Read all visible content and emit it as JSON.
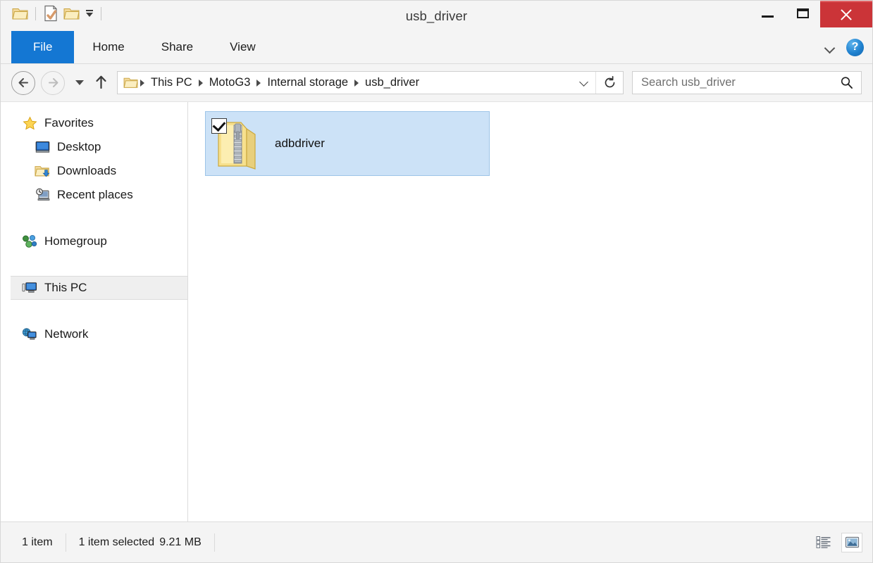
{
  "window": {
    "title": "usb_driver",
    "quick_access": {
      "app_icon": "folder-icon",
      "items": [
        {
          "name": "properties-icon",
          "label": "Properties"
        },
        {
          "name": "new-folder-icon",
          "label": "New folder"
        },
        {
          "name": "customize-caret-icon",
          "label": "Customize Quick Access Toolbar"
        }
      ]
    },
    "controls": {
      "minimize": "Minimize",
      "maximize": "Maximize",
      "close": "Close"
    },
    "accent_blue": "#1477d3",
    "close_red": "#cb3438",
    "selection_blue": "#cce2f7"
  },
  "ribbon": {
    "tabs": [
      {
        "label": "File",
        "active": true
      },
      {
        "label": "Home",
        "active": false
      },
      {
        "label": "Share",
        "active": false
      },
      {
        "label": "View",
        "active": false
      }
    ],
    "expand_label": "Expand the Ribbon",
    "help_label": "?"
  },
  "address": {
    "back_label": "Back",
    "forward_label": "Forward",
    "recent_label": "Recent locations",
    "up_label": "Up one level",
    "folder_icon": "folder-icon",
    "breadcrumbs": [
      "This PC",
      "MotoG3",
      "Internal storage",
      "usb_driver"
    ],
    "dropdown_label": "Previous locations",
    "refresh_label": "Refresh"
  },
  "search": {
    "placeholder": "Search usb_driver",
    "icon": "search-icon"
  },
  "sidebar": {
    "groups": [
      {
        "header": {
          "label": "Favorites",
          "icon": "star-icon"
        },
        "items": [
          {
            "label": "Desktop",
            "icon": "desktop-icon"
          },
          {
            "label": "Downloads",
            "icon": "downloads-folder-icon"
          },
          {
            "label": "Recent places",
            "icon": "recent-places-icon"
          }
        ]
      },
      {
        "header": {
          "label": "Homegroup",
          "icon": "homegroup-icon"
        },
        "items": []
      },
      {
        "header": {
          "label": "This PC",
          "icon": "this-pc-icon",
          "selected": true
        },
        "items": []
      },
      {
        "header": {
          "label": "Network",
          "icon": "network-icon"
        },
        "items": []
      }
    ]
  },
  "content": {
    "files": [
      {
        "name": "adbdriver",
        "icon": "zip-folder-icon",
        "selected": true,
        "checked": true
      }
    ]
  },
  "status": {
    "item_count": "1 item",
    "selection": "1 item selected",
    "size": "9.21 MB",
    "views": [
      {
        "name": "details-view-button",
        "label": "Details view",
        "active": false
      },
      {
        "name": "large-icons-view-button",
        "label": "Large icons view",
        "active": true
      }
    ]
  }
}
